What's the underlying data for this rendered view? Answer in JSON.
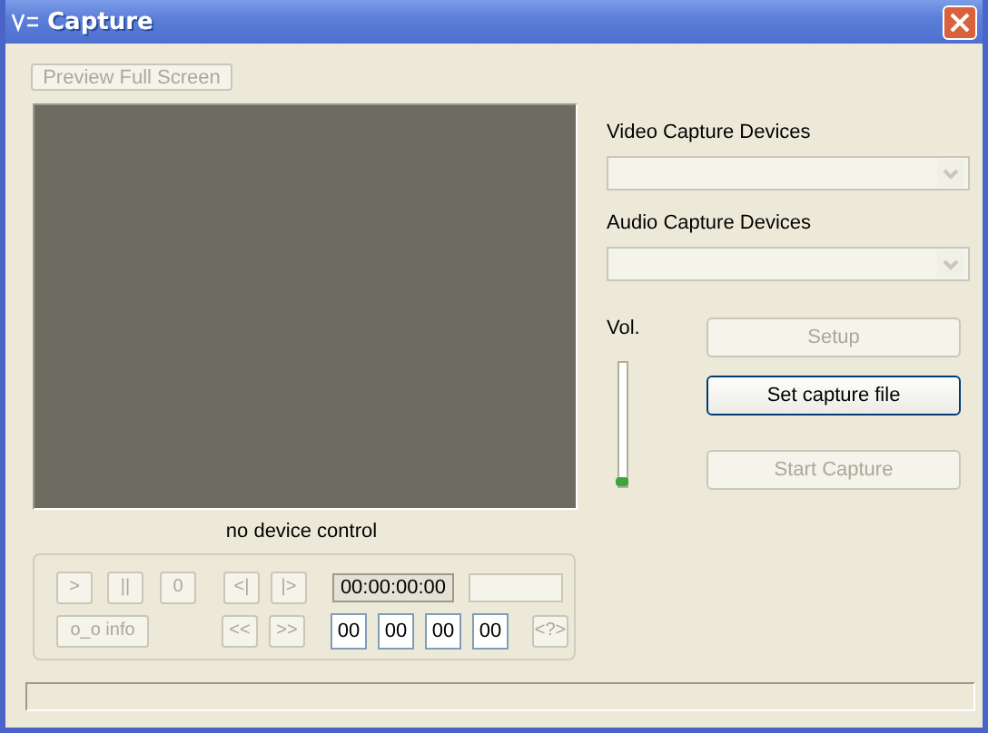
{
  "window": {
    "title": "Capture"
  },
  "preview_button": {
    "label": "Preview Full Screen",
    "disabled": true
  },
  "device_control_label": "no device control",
  "video_devices": {
    "label": "Video Capture Devices",
    "disabled": true
  },
  "audio_devices": {
    "label": "Audio Capture Devices",
    "disabled": true
  },
  "volume": {
    "label": "Vol.",
    "level": 0
  },
  "buttons": [
    {
      "label": "Setup",
      "disabled": true
    },
    {
      "label": "Set capture file",
      "disabled": false
    },
    {
      "label": "Start Capture",
      "disabled": true
    }
  ],
  "transport_row_1": [
    {
      "label": ">",
      "disabled": true
    },
    {
      "label": "||",
      "disabled": true
    },
    {
      "label": "0",
      "disabled": true
    },
    {
      "label": "<|",
      "disabled": true
    },
    {
      "label": "|>",
      "disabled": true
    }
  ],
  "timecode": "00:00:00:00",
  "transport_row_2": [
    {
      "label": "o_o info",
      "disabled": true
    },
    {
      "label": "<<",
      "disabled": true
    },
    {
      "label": ">>",
      "disabled": true
    }
  ],
  "time_fields": [
    "00",
    "00",
    "00",
    "00"
  ],
  "goto_button": {
    "label": "<?>",
    "disabled": true
  }
}
